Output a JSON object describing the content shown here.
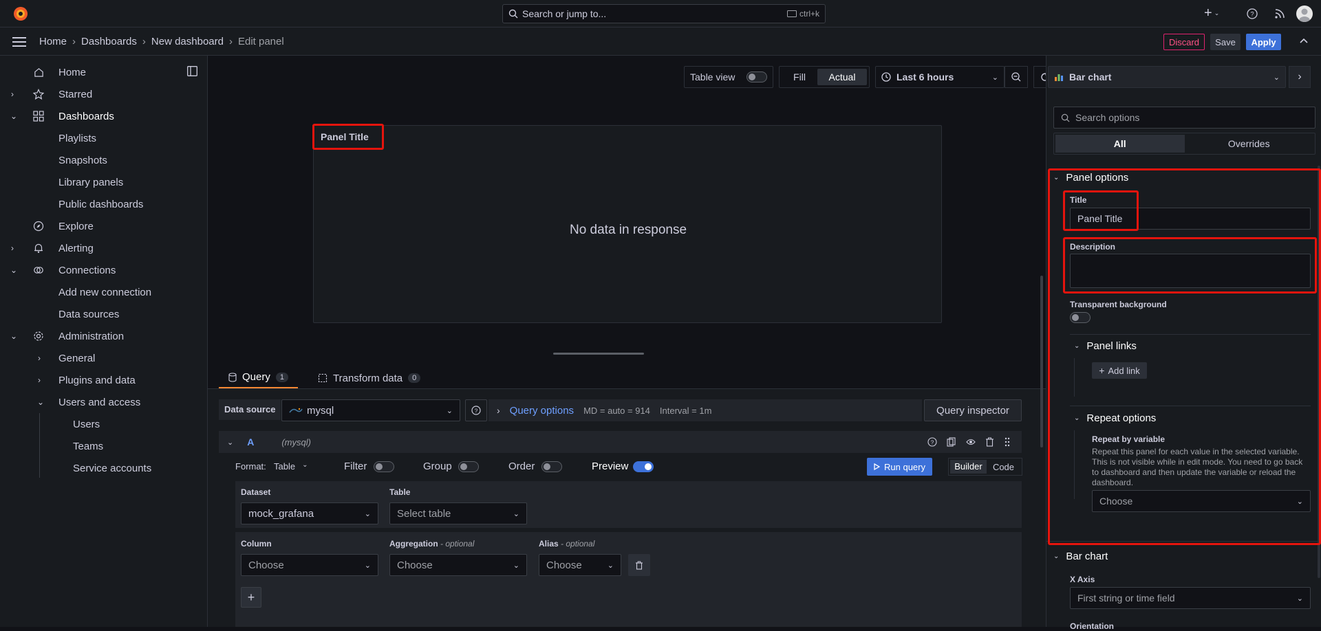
{
  "topbar": {
    "search_placeholder": "Search or jump to...",
    "search_shortcut": "ctrl+k",
    "plus_label": "+"
  },
  "breadcrumb": [
    "Home",
    "Dashboards",
    "New dashboard",
    "Edit panel"
  ],
  "toolbar": {
    "discard": "Discard",
    "save": "Save",
    "apply": "Apply"
  },
  "sidebar": {
    "items": [
      {
        "label": "Home"
      },
      {
        "label": "Starred"
      },
      {
        "label": "Dashboards"
      },
      {
        "label": "Playlists"
      },
      {
        "label": "Snapshots"
      },
      {
        "label": "Library panels"
      },
      {
        "label": "Public dashboards"
      },
      {
        "label": "Explore"
      },
      {
        "label": "Alerting"
      },
      {
        "label": "Connections"
      },
      {
        "label": "Add new connection"
      },
      {
        "label": "Data sources"
      },
      {
        "label": "Administration"
      },
      {
        "label": "General"
      },
      {
        "label": "Plugins and data"
      },
      {
        "label": "Users and access"
      },
      {
        "label": "Users"
      },
      {
        "label": "Teams"
      },
      {
        "label": "Service accounts"
      }
    ]
  },
  "panel_toolbar": {
    "table_view": "Table view",
    "fill": "Fill",
    "actual": "Actual",
    "time_range": "Last 6 hours"
  },
  "panel": {
    "title": "Panel Title",
    "empty_message": "No data in response"
  },
  "query_tabs": {
    "query_label": "Query",
    "query_count": "1",
    "transform_label": "Transform data",
    "transform_count": "0"
  },
  "datasource": {
    "label": "Data source",
    "value": "mysql",
    "query_options": "Query options",
    "md": "MD = auto = 914",
    "interval": "Interval = 1m",
    "inspector": "Query inspector"
  },
  "query": {
    "ref": "A",
    "ds": "(mysql)",
    "format_label": "Format:",
    "format_value": "Table",
    "filter": "Filter",
    "group": "Group",
    "order": "Order",
    "preview": "Preview",
    "run": "Run query",
    "builder": "Builder",
    "code": "Code",
    "dataset_label": "Dataset",
    "dataset_value": "mock_grafana",
    "table_label": "Table",
    "table_placeholder": "Select table",
    "column_label": "Column",
    "column_value": "Choose",
    "aggregation_label": "Aggregation",
    "aggregation_optional": "- optional",
    "aggregation_value": "Choose",
    "alias_label": "Alias",
    "alias_optional": "- optional",
    "alias_value": "Choose",
    "add": "+"
  },
  "options": {
    "viz": "Bar chart",
    "search_placeholder": "Search options",
    "tab_all": "All",
    "tab_overrides": "Overrides",
    "panel_options": "Panel options",
    "title_label": "Title",
    "title_value": "Panel Title",
    "description_label": "Description",
    "transparent_label": "Transparent background",
    "panel_links": "Panel links",
    "add_link": "Add link",
    "repeat_options": "Repeat options",
    "repeat_by_label": "Repeat by variable",
    "repeat_help": "Repeat this panel for each value in the selected variable. This is not visible while in edit mode. You need to go back to dashboard and then update the variable or reload the dashboard.",
    "repeat_value": "Choose",
    "bar_chart_section": "Bar chart",
    "x_axis_label": "X Axis",
    "x_axis_value": "First string or time field",
    "orientation_label": "Orientation"
  },
  "colors": {
    "accent": "#3d71d9",
    "highlight": "#e5140d",
    "orange": "#ff8833"
  }
}
